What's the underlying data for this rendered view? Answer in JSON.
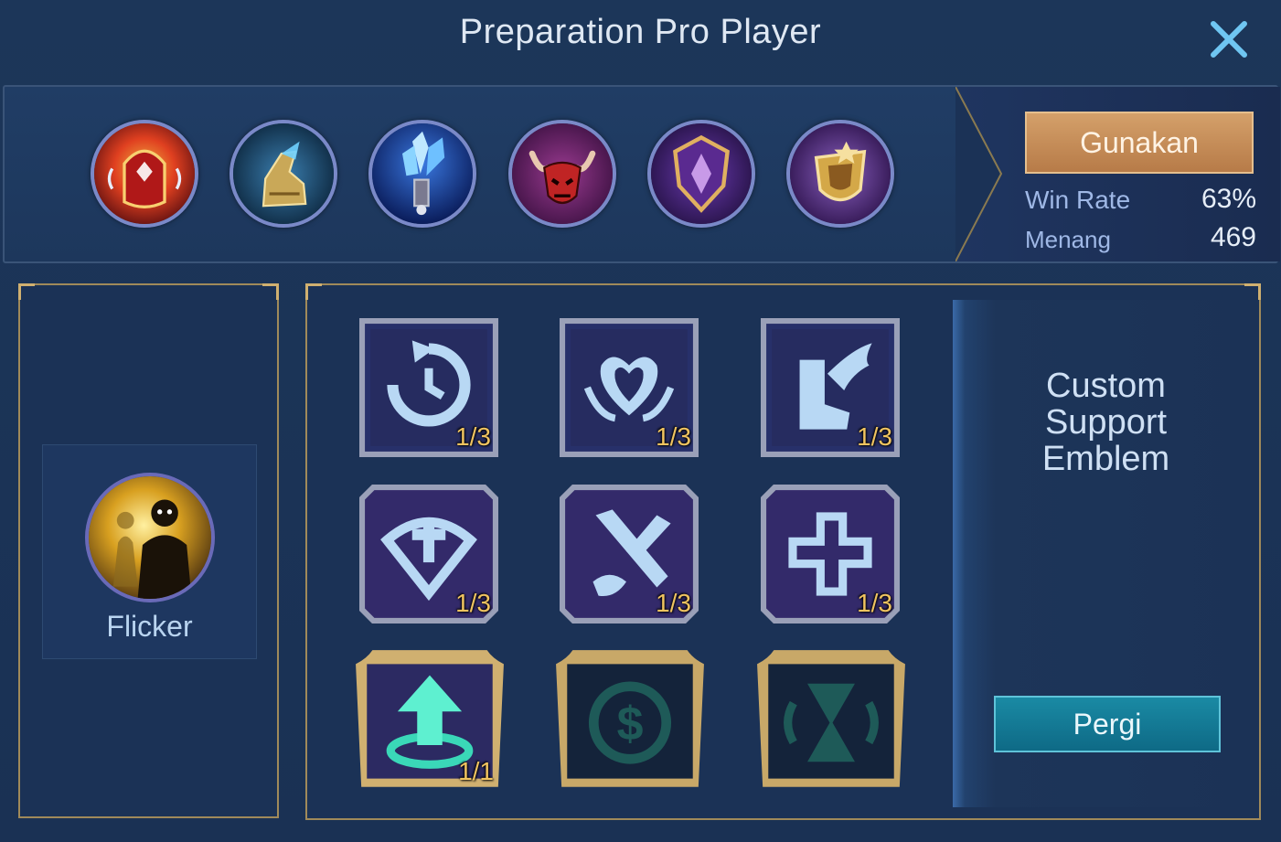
{
  "header": {
    "title": "Preparation Pro Player",
    "close_icon": "close-icon"
  },
  "build": {
    "items": [
      {
        "name": "item-1",
        "icon": "red-flame-helm-icon",
        "colors": [
          "#8a1a10",
          "#e04020",
          "#f0b040"
        ]
      },
      {
        "name": "item-2",
        "icon": "golden-boots-icon",
        "colors": [
          "#0e2f48",
          "#3b7fb0",
          "#d4b060"
        ]
      },
      {
        "name": "item-3",
        "icon": "ice-crystal-sword-icon",
        "colors": [
          "#0c2a70",
          "#4aa8ff",
          "#bfe8ff"
        ]
      },
      {
        "name": "item-4",
        "icon": "horned-red-mask-icon",
        "colors": [
          "#4a1850",
          "#c03030",
          "#e8c8b0"
        ]
      },
      {
        "name": "item-5",
        "icon": "purple-shield-icon",
        "colors": [
          "#2a1850",
          "#8a50c0",
          "#e0b060"
        ]
      },
      {
        "name": "item-6",
        "icon": "golden-amulet-icon",
        "colors": [
          "#3a1a5a",
          "#8a60c0",
          "#e0b050"
        ]
      }
    ],
    "use_label": "Gunakan",
    "win_rate_label": "Win Rate",
    "win_rate_value": "63%",
    "wins_label": "Menang",
    "wins_value": "469"
  },
  "spell": {
    "name": "Flicker",
    "icon": "flicker-silhouette-icon"
  },
  "emblem": {
    "title": "Custom Support Emblem",
    "go_label": "Pergi",
    "talents": [
      {
        "icon": "cooldown-arrows-icon",
        "count": "1/3",
        "tier": 1,
        "active": true
      },
      {
        "icon": "heart-wings-icon",
        "count": "1/3",
        "tier": 1,
        "active": true
      },
      {
        "icon": "winged-boot-icon",
        "count": "1/3",
        "tier": 1,
        "active": true
      },
      {
        "icon": "shield-cross-icon",
        "count": "1/3",
        "tier": 2,
        "active": true
      },
      {
        "icon": "sword-cross-icon",
        "count": "1/3",
        "tier": 2,
        "active": true
      },
      {
        "icon": "plus-cross-icon",
        "count": "1/3",
        "tier": 2,
        "active": true
      },
      {
        "icon": "arrow-up-circle-icon",
        "count": "1/1",
        "tier": 3,
        "active": true
      },
      {
        "icon": "coin-cycle-icon",
        "count": "",
        "tier": 3,
        "active": false
      },
      {
        "icon": "hourglass-icon",
        "count": "",
        "tier": 3,
        "active": false
      }
    ]
  },
  "colors": {
    "background": "#1b3358",
    "gold_frame": "#a08a5a",
    "use_button": "#c48c56",
    "go_button": "#137894",
    "count_text": "#f0c460",
    "accent_blue": "#9fb8e6"
  }
}
